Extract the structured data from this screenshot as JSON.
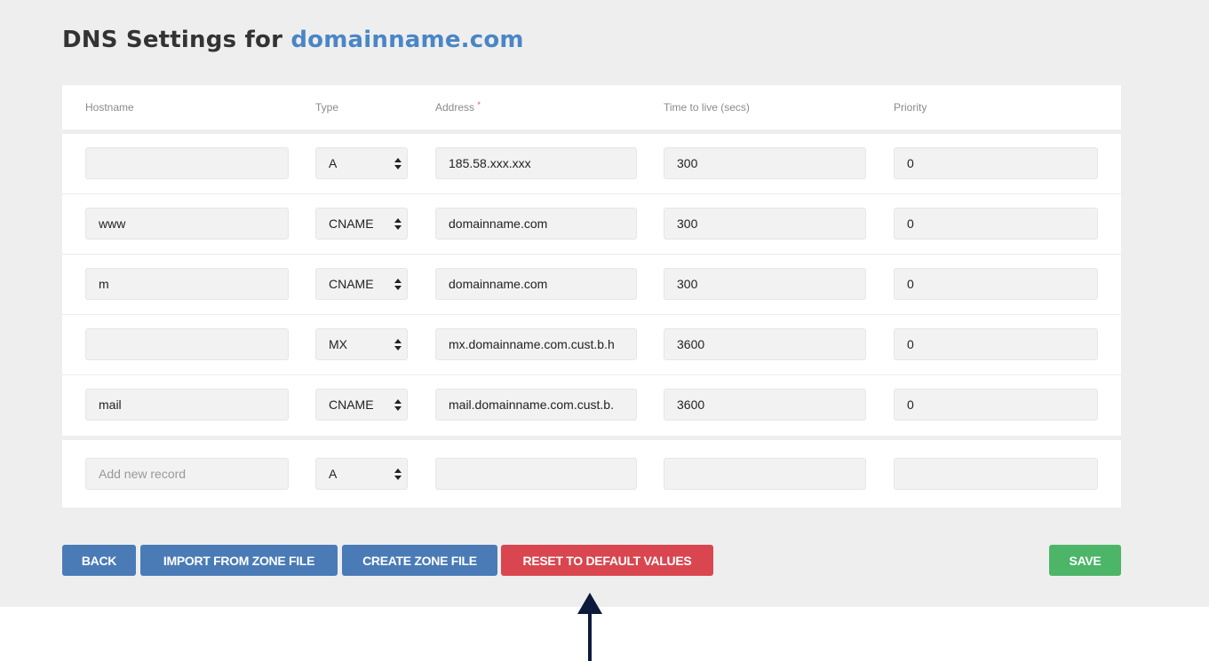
{
  "page": {
    "title_prefix": "DNS Settings for ",
    "domain": "domainname.com"
  },
  "columns": {
    "hostname": "Hostname",
    "type": "Type",
    "address": "Address",
    "address_required_marker": "*",
    "ttl": "Time to live (secs)",
    "priority": "Priority"
  },
  "records": [
    {
      "hostname": "",
      "type": "A",
      "address": "185.58.xxx.xxx",
      "ttl": "300",
      "priority": "0"
    },
    {
      "hostname": "www",
      "type": "CNAME",
      "address": "domainname.com",
      "ttl": "300",
      "priority": "0"
    },
    {
      "hostname": "m",
      "type": "CNAME",
      "address": "domainname.com",
      "ttl": "300",
      "priority": "0"
    },
    {
      "hostname": "",
      "type": "MX",
      "address": "mx.domainname.com.cust.b.h",
      "ttl": "3600",
      "priority": "0"
    },
    {
      "hostname": "mail",
      "type": "CNAME",
      "address": "mail.domainname.com.cust.b.",
      "ttl": "3600",
      "priority": "0"
    }
  ],
  "new_record": {
    "hostname_placeholder": "Add new record",
    "type": "A",
    "address": "",
    "ttl": "",
    "priority": ""
  },
  "buttons": {
    "back": "BACK",
    "import": "IMPORT FROM ZONE FILE",
    "create": "CREATE ZONE FILE",
    "reset": "RESET TO DEFAULT VALUES",
    "save": "SAVE"
  },
  "colors": {
    "primary_blue": "#4a7bb7",
    "danger_red": "#d9464f",
    "success_green": "#4cb568",
    "link_blue": "#4a86c5",
    "annotation_arrow": "#0d1a3c"
  },
  "icons": {
    "select_arrows": "updown-chevron-icon",
    "annotation": "up-arrow-icon"
  }
}
